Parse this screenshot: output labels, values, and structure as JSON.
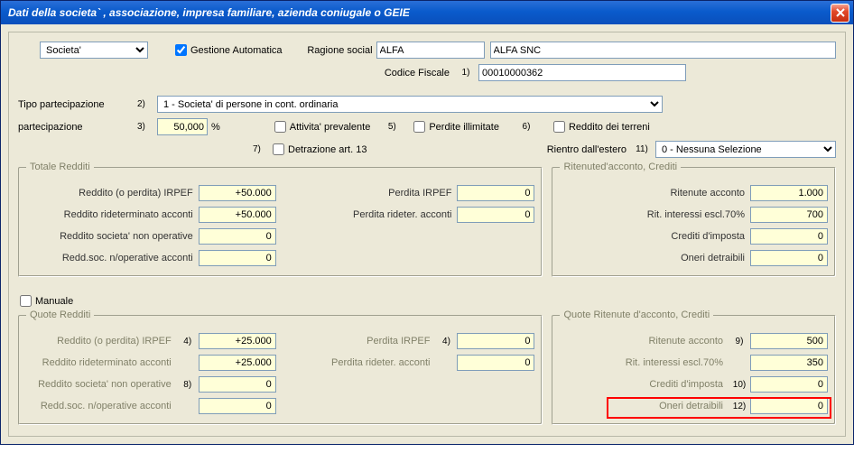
{
  "window": {
    "title": "Dati della societa` , associazione, impresa familiare, azienda coniugale o GEIE"
  },
  "top": {
    "tipo_soggetto": "Societa'",
    "gestione_auto_label": "Gestione Automatica",
    "gestione_auto_checked": true,
    "ragione_social_label": "Ragione social",
    "ragione_social_code": "ALFA",
    "ragione_social_name": "ALFA SNC",
    "codice_fiscale_label": "Codice Fiscale",
    "codice_fiscale_idx": "1)",
    "codice_fiscale": "00010000362"
  },
  "partec": {
    "tipo_label": "Tipo partecipazione",
    "tipo_idx": "2)",
    "tipo_value": "1 - Societa' di persone in cont. ordinaria",
    "part_label": "partecipazione",
    "part_idx": "3)",
    "part_value": "50,000",
    "pct": "%",
    "attivita_label": "Attivita' prevalente",
    "idx5": "5)",
    "perdite_label": "Perdite illimitate",
    "idx6": "6)",
    "reddito_terreni_label": "Reddito dei terreni",
    "idx7": "7)",
    "detrazione_label": "Detrazione art. 13",
    "rientro_label": "Rientro dall'estero",
    "idx11": "11)",
    "rientro_value": "0  - Nessuna Selezione"
  },
  "totali": {
    "legend": "Totale Redditi",
    "reddito_irpef_label": "Reddito (o perdita)  IRPEF",
    "reddito_irpef": "+50.000",
    "reddito_rid_label": "Reddito rideterminato acconti",
    "reddito_rid": "+50.000",
    "reddito_nop_label": "Reddito societa' non operative",
    "reddito_nop": "0",
    "reddsoc_nop_label": "Redd.soc. n/operative acconti",
    "reddsoc_nop": "0",
    "perdita_irpef_label": "Perdita  IRPEF",
    "perdita_irpef": "0",
    "perdita_rid_label": "Perdita rideter. acconti",
    "perdita_rid": "0"
  },
  "ritenute": {
    "legend": "Ritenuted'acconto, Crediti",
    "rit_acc_label": "Ritenute acconto",
    "rit_acc": "1.000",
    "rit_int_label": "Rit. interessi escl.70%",
    "rit_int": "700",
    "cred_imp_label": "Crediti d'imposta",
    "cred_imp": "0",
    "oneri_label": "Oneri detraibili",
    "oneri": "0"
  },
  "manuale": {
    "label": "Manuale",
    "checked": false
  },
  "quote": {
    "legend": "Quote Redditi",
    "reddito_irpef_label": "Reddito (o perdita)  IRPEF",
    "reddito_irpef_idx": "4)",
    "reddito_irpef": "+25.000",
    "reddito_rid_label": "Reddito rideterminato acconti",
    "reddito_rid": "+25.000",
    "reddito_nop_label": "Reddito societa' non operative",
    "reddito_nop_idx": "8)",
    "reddito_nop": "0",
    "reddsoc_nop_label": "Redd.soc. n/operative acconti",
    "reddsoc_nop": "0",
    "perdita_irpef_label": "Perdita  IRPEF",
    "perdita_irpef_idx": "4)",
    "perdita_irpef": "0",
    "perdita_rid_label": "Perdita rideter. acconti",
    "perdita_rid": "0"
  },
  "quote_rit": {
    "legend": "Quote Ritenute d'acconto, Crediti",
    "rit_acc_label": "Ritenute acconto",
    "rit_acc_idx": "9)",
    "rit_acc": "500",
    "rit_int_label": "Rit. interessi escl.70%",
    "rit_int": "350",
    "cred_imp_label": "Crediti d'imposta",
    "cred_imp_idx": "10)",
    "cred_imp": "0",
    "oneri_label": "Oneri detraibili",
    "oneri_idx": "12)",
    "oneri": "0"
  }
}
